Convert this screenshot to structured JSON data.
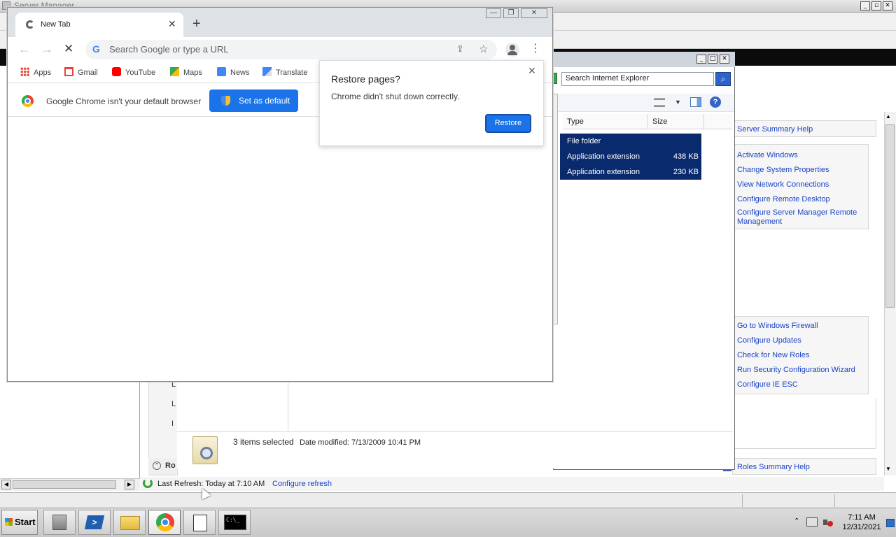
{
  "server_manager": {
    "title": "Server Manager",
    "collapse_label": "Ro",
    "tree_letters": [
      "L",
      "L",
      "I"
    ],
    "links_top": [
      "Server Summary Help",
      "Activate Windows",
      "Change System Properties",
      "View Network Connections",
      "Configure Remote Desktop",
      "Configure Server Manager Remote",
      "Management"
    ],
    "links_bottom": [
      "Go to Windows Firewall",
      "Configure Updates",
      "Check for New Roles",
      "Run Security Configuration Wizard",
      "Configure IE ESC"
    ],
    "roles_help": "Roles Summary Help",
    "last_refresh": "Last Refresh: Today at 7:10 AM",
    "configure_refresh": "Configure refresh"
  },
  "explorer": {
    "search_placeholder": "Search Internet Explorer",
    "columns": {
      "type": "Type",
      "size": "Size"
    },
    "rows": [
      {
        "type": "File folder",
        "size": ""
      },
      {
        "type": "Application extension",
        "size": "438 KB"
      },
      {
        "type": "Application extension",
        "size": "230 KB"
      }
    ],
    "details_count": "3 items selected",
    "details_date": "Date modified:  7/13/2009 10:41 PM"
  },
  "chrome": {
    "tab_title": "New Tab",
    "omnibox_placeholder": "Search Google or type a URL",
    "bookmarks": [
      "Apps",
      "Gmail",
      "YouTube",
      "Maps",
      "News",
      "Translate"
    ],
    "infobar_text": "Google Chrome isn't your default browser",
    "set_default_label": "Set as default",
    "restore_title": "Restore pages?",
    "restore_message": "Chrome didn't shut down correctly.",
    "restore_button": "Restore"
  },
  "taskbar": {
    "start_label": "Start",
    "time": "7:11 AM",
    "date": "12/31/2021"
  },
  "colors": {
    "chrome_blue": "#1a73e8",
    "selection_navy": "#0a2a6e",
    "link_blue": "#1a43c7"
  }
}
